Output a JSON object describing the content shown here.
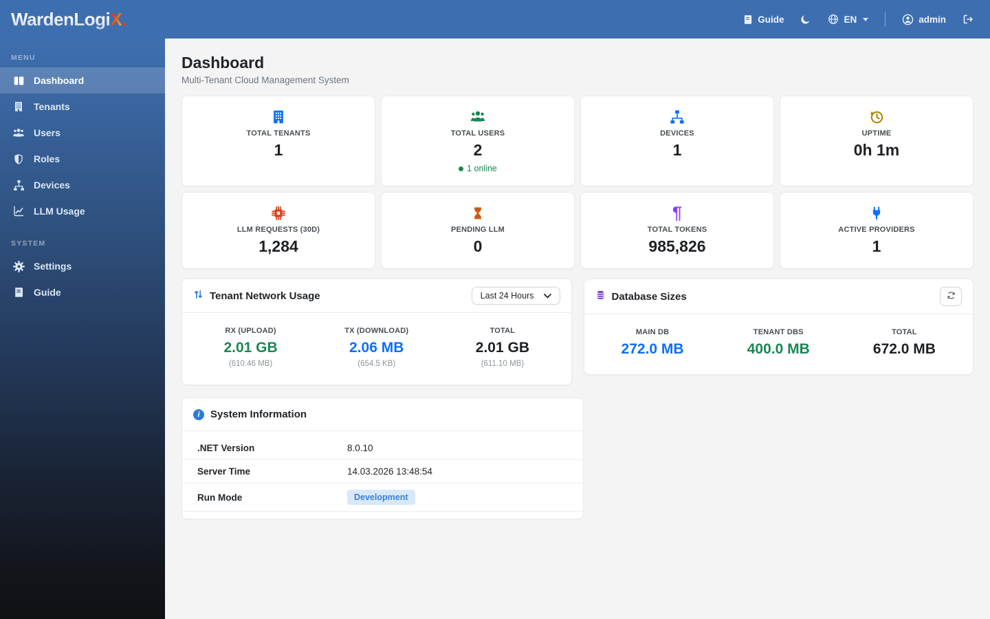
{
  "brand": {
    "name_main": "WardenLogi",
    "name_accent": "X"
  },
  "topbar": {
    "guide_label": "Guide",
    "language": "EN",
    "username": "admin",
    "icons": [
      "book-icon",
      "moon-icon",
      "globe-icon",
      "person-circle-icon",
      "logout-icon"
    ]
  },
  "sidebar": {
    "menu_label": "MENU",
    "system_label": "SYSTEM",
    "items": [
      {
        "label": "Dashboard",
        "icon": "dashboard-icon",
        "active": true
      },
      {
        "label": "Tenants",
        "icon": "building-icon",
        "active": false
      },
      {
        "label": "Users",
        "icon": "users-icon",
        "active": false
      },
      {
        "label": "Roles",
        "icon": "shield-icon",
        "active": false
      },
      {
        "label": "Devices",
        "icon": "sitemap-icon",
        "active": false
      },
      {
        "label": "LLM Usage",
        "icon": "chart-icon",
        "active": false
      }
    ],
    "system_items": [
      {
        "label": "Settings",
        "icon": "gear-icon"
      },
      {
        "label": "Guide",
        "icon": "book-icon"
      }
    ]
  },
  "page": {
    "title": "Dashboard",
    "subtitle": "Multi-Tenant Cloud Management System"
  },
  "stats": [
    {
      "label": "TOTAL TENANTS",
      "value": "1",
      "icon": "building-icon",
      "icon_color": "#0d6efd"
    },
    {
      "label": "TOTAL USERS",
      "value": "2",
      "extra": "1 online",
      "icon": "users-icon",
      "icon_color": "#198754"
    },
    {
      "label": "DEVICES",
      "value": "1",
      "icon": "sitemap-icon",
      "icon_color": "#0d6efd"
    },
    {
      "label": "UPTIME",
      "value": "0h 1m",
      "icon": "clock-history-icon",
      "icon_color": "#a98604"
    },
    {
      "label": "LLM REQUESTS (30D)",
      "value": "1,284",
      "icon": "cpu-icon",
      "icon_color": "#d6411a"
    },
    {
      "label": "PENDING LLM",
      "value": "0",
      "icon": "hourglass-icon",
      "icon_color": "#cd5a12"
    },
    {
      "label": "TOTAL TOKENS",
      "value": "985,826",
      "icon": "pilcrow-icon",
      "icon_color": "#8a3ff0"
    },
    {
      "label": "ACTIVE PROVIDERS",
      "value": "1",
      "icon": "plug-icon",
      "icon_color": "#0d6efd"
    }
  ],
  "network_panel": {
    "title": "Tenant Network Usage",
    "icon": "arrows-up-down-icon",
    "range_selected": "Last 24 Hours",
    "columns": [
      {
        "label": "RX (UPLOAD)",
        "value": "2.01 GB",
        "sub": "(610.46 MB)",
        "color": "#198754"
      },
      {
        "label": "TX (DOWNLOAD)",
        "value": "2.06 MB",
        "sub": "(654.5 KB)",
        "color": "#0d6efd"
      },
      {
        "label": "TOTAL",
        "value": "2.01 GB",
        "sub": "(611.10 MB)",
        "color": "#1e2124"
      }
    ]
  },
  "database_panel": {
    "title": "Database Sizes",
    "icon": "database-icon",
    "columns": [
      {
        "label": "MAIN DB",
        "value": "272.0 MB",
        "color": "#0d6efd"
      },
      {
        "label": "TENANT DBS",
        "value": "400.0 MB",
        "color": "#198754"
      },
      {
        "label": "TOTAL",
        "value": "672.0 MB",
        "color": "#1e2124"
      }
    ]
  },
  "system_panel": {
    "title": "System Information",
    "icon": "info-icon",
    "rows": [
      {
        "label": ".NET Version",
        "value": "8.0.10",
        "type": "text"
      },
      {
        "label": "Server Time",
        "value": "14.03.2026 13:48:54",
        "type": "text"
      },
      {
        "label": "Run Mode",
        "value": "Development",
        "type": "badge"
      }
    ]
  },
  "colors": {
    "topbar": "#3d6fb0",
    "sidebar_top": "#3e6fb0",
    "sidebar_bottom": "#101114",
    "background": "#f4f4f5",
    "success": "#198754",
    "primary": "#0d6efd",
    "badge_bg": "#d9e8f8",
    "badge_text": "#3584d6"
  }
}
